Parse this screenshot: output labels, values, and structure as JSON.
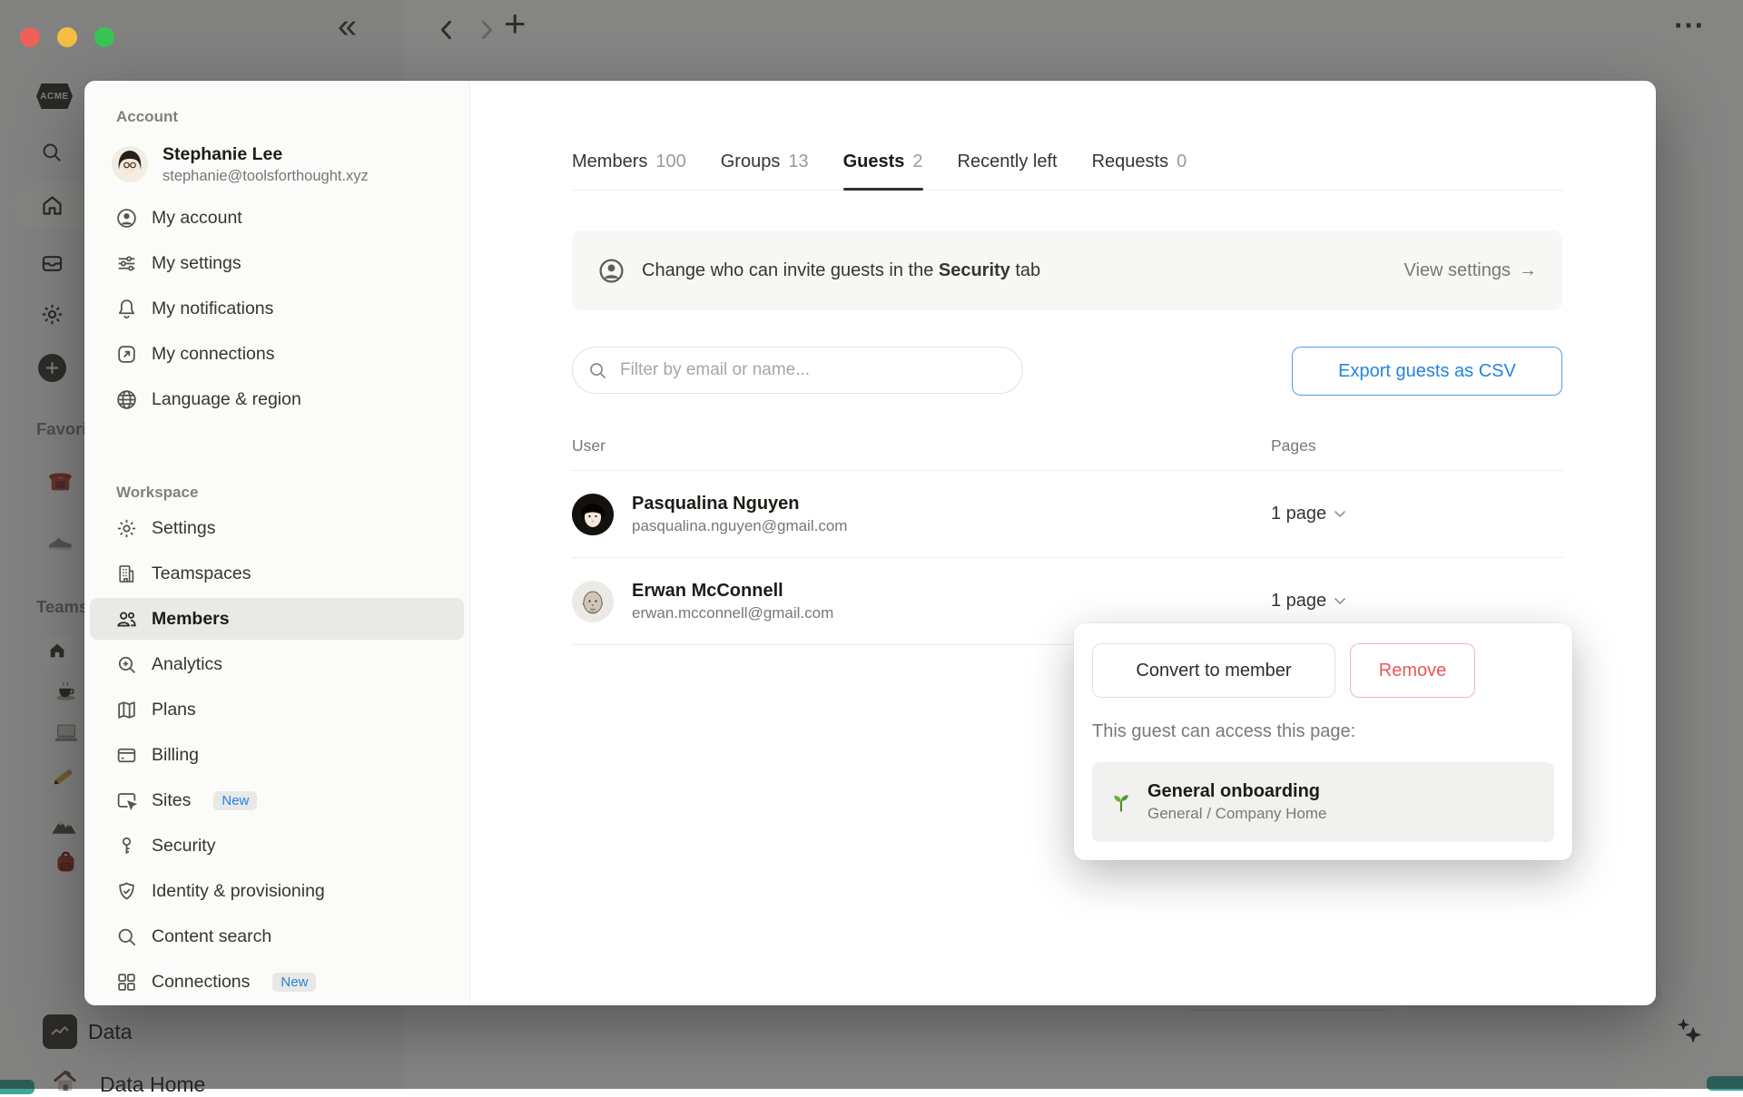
{
  "icons": {
    "collapse_sidebar": "«",
    "new_tab_plus": "+",
    "more": "⋯",
    "arrow_right": "→"
  },
  "backdrop": {
    "logo": "ACME",
    "favorites_label": "Favorites",
    "teamspaces_label": "Teamspaces",
    "data_label": "Data",
    "data_home_label": "Data Home"
  },
  "modal": {
    "nav": {
      "account": {
        "label": "Account",
        "user": {
          "name": "Stephanie Lee",
          "email": "stephanie@toolsforthought.xyz"
        },
        "items": [
          {
            "label": "My account"
          },
          {
            "label": "My settings"
          },
          {
            "label": "My notifications"
          },
          {
            "label": "My connections"
          },
          {
            "label": "Language & region"
          }
        ]
      },
      "workspace": {
        "label": "Workspace",
        "items": [
          {
            "label": "Settings"
          },
          {
            "label": "Teamspaces"
          },
          {
            "label": "Members"
          },
          {
            "label": "Analytics"
          },
          {
            "label": "Plans"
          },
          {
            "label": "Billing"
          },
          {
            "label": "Sites",
            "badge": "New"
          },
          {
            "label": "Security"
          },
          {
            "label": "Identity & provisioning"
          },
          {
            "label": "Content search"
          },
          {
            "label": "Connections",
            "badge": "New"
          }
        ]
      }
    },
    "main": {
      "tabs": [
        {
          "label": "Members",
          "count": "100"
        },
        {
          "label": "Groups",
          "count": "13"
        },
        {
          "label": "Guests",
          "count": "2"
        },
        {
          "label": "Recently left",
          "count": ""
        },
        {
          "label": "Requests",
          "count": "0"
        }
      ],
      "banner": {
        "text_prefix": "Change who can invite guests in the ",
        "text_bold": "Security",
        "text_suffix": " tab",
        "action_label": "View settings"
      },
      "filter_placeholder": "Filter by email or name...",
      "export_label": "Export guests as CSV",
      "table": {
        "col_user": "User",
        "col_pages": "Pages",
        "rows": [
          {
            "name": "Pasqualina Nguyen",
            "email": "pasqualina.nguyen@gmail.com",
            "pages": "1 page"
          },
          {
            "name": "Erwan McConnell",
            "email": "erwan.mcconnell@gmail.com",
            "pages": "1 page"
          }
        ]
      }
    },
    "popover": {
      "convert_label": "Convert to member",
      "remove_label": "Remove",
      "caption": "This guest can access this page:",
      "page_title": "General onboarding",
      "page_breadcrumb": "General / Company Home"
    }
  },
  "colors": {
    "accent_blue": "#2383e2",
    "danger_red": "#eb5757",
    "traffic_red": "#ee6158",
    "traffic_yellow": "#f5bd42",
    "traffic_green": "#37c653"
  }
}
